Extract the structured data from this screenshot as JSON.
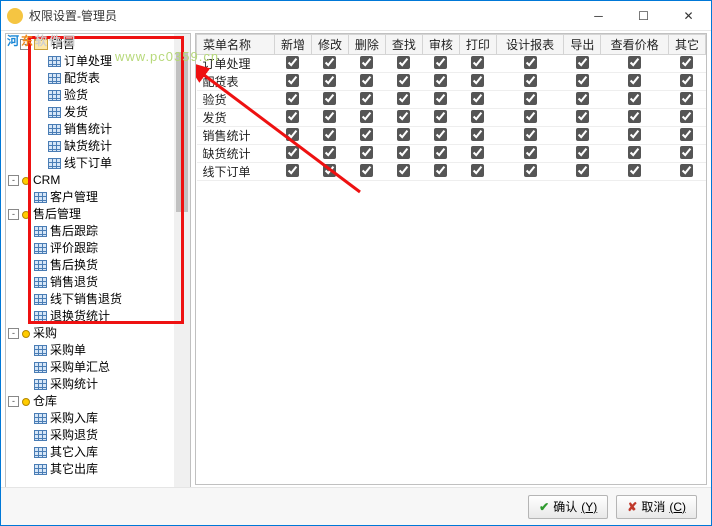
{
  "window": {
    "title": "权限设置-管理员"
  },
  "watermark": {
    "brand_a": "河",
    "brand_b": "东",
    "brand_c": "软件园",
    "url": "www.pc0359.cn"
  },
  "tree": [
    {
      "indent": 1,
      "toggle": "-",
      "icon": "fold",
      "label": "销售"
    },
    {
      "indent": 2,
      "toggle": "",
      "icon": "grid",
      "label": "订单处理"
    },
    {
      "indent": 2,
      "toggle": "",
      "icon": "grid",
      "label": "配货表"
    },
    {
      "indent": 2,
      "toggle": "",
      "icon": "grid",
      "label": "验货"
    },
    {
      "indent": 2,
      "toggle": "",
      "icon": "grid",
      "label": "发货"
    },
    {
      "indent": 2,
      "toggle": "",
      "icon": "grid",
      "label": "销售统计"
    },
    {
      "indent": 2,
      "toggle": "",
      "icon": "grid",
      "label": "缺货统计"
    },
    {
      "indent": 2,
      "toggle": "",
      "icon": "grid",
      "label": "线下订单"
    },
    {
      "indent": 0,
      "toggle": "-",
      "icon": "bullet",
      "label": "CRM"
    },
    {
      "indent": 1,
      "toggle": "",
      "icon": "grid",
      "label": "客户管理"
    },
    {
      "indent": 0,
      "toggle": "-",
      "icon": "bullet",
      "label": "售后管理"
    },
    {
      "indent": 1,
      "toggle": "",
      "icon": "grid",
      "label": "售后跟踪"
    },
    {
      "indent": 1,
      "toggle": "",
      "icon": "grid",
      "label": "评价跟踪"
    },
    {
      "indent": 1,
      "toggle": "",
      "icon": "grid",
      "label": "售后换货"
    },
    {
      "indent": 1,
      "toggle": "",
      "icon": "grid",
      "label": "销售退货"
    },
    {
      "indent": 1,
      "toggle": "",
      "icon": "grid",
      "label": "线下销售退货"
    },
    {
      "indent": 1,
      "toggle": "",
      "icon": "grid",
      "label": "退换货统计"
    },
    {
      "indent": 0,
      "toggle": "-",
      "icon": "bullet",
      "label": "采购"
    },
    {
      "indent": 1,
      "toggle": "",
      "icon": "grid",
      "label": "采购单"
    },
    {
      "indent": 1,
      "toggle": "",
      "icon": "grid",
      "label": "采购单汇总"
    },
    {
      "indent": 1,
      "toggle": "",
      "icon": "grid",
      "label": "采购统计"
    },
    {
      "indent": 0,
      "toggle": "-",
      "icon": "bullet",
      "label": "仓库"
    },
    {
      "indent": 1,
      "toggle": "",
      "icon": "grid",
      "label": "采购入库"
    },
    {
      "indent": 1,
      "toggle": "",
      "icon": "grid",
      "label": "采购退货"
    },
    {
      "indent": 1,
      "toggle": "",
      "icon": "grid",
      "label": "其它入库"
    },
    {
      "indent": 1,
      "toggle": "",
      "icon": "grid",
      "label": "其它出库"
    }
  ],
  "table": {
    "headers": [
      "菜单名称",
      "新增",
      "修改",
      "删除",
      "查找",
      "审核",
      "打印",
      "设计报表",
      "导出",
      "查看价格",
      "其它"
    ],
    "rows": [
      {
        "name": "订单处理",
        "checks": [
          true,
          true,
          true,
          true,
          true,
          true,
          true,
          true,
          true,
          true
        ]
      },
      {
        "name": "配货表",
        "checks": [
          true,
          true,
          true,
          true,
          true,
          true,
          true,
          true,
          true,
          true
        ]
      },
      {
        "name": "验货",
        "checks": [
          true,
          true,
          true,
          true,
          true,
          true,
          true,
          true,
          true,
          true
        ]
      },
      {
        "name": "发货",
        "checks": [
          true,
          true,
          true,
          true,
          true,
          true,
          true,
          true,
          true,
          true
        ]
      },
      {
        "name": "销售统计",
        "checks": [
          true,
          true,
          true,
          true,
          true,
          true,
          true,
          true,
          true,
          true
        ]
      },
      {
        "name": "缺货统计",
        "checks": [
          true,
          true,
          true,
          true,
          true,
          true,
          true,
          true,
          true,
          true
        ]
      },
      {
        "name": "线下订单",
        "checks": [
          true,
          true,
          true,
          true,
          true,
          true,
          true,
          true,
          true,
          true
        ]
      }
    ]
  },
  "buttons": {
    "ok": "确认",
    "ok_key": "(Y)",
    "cancel": "取消",
    "cancel_key": "(C)"
  }
}
